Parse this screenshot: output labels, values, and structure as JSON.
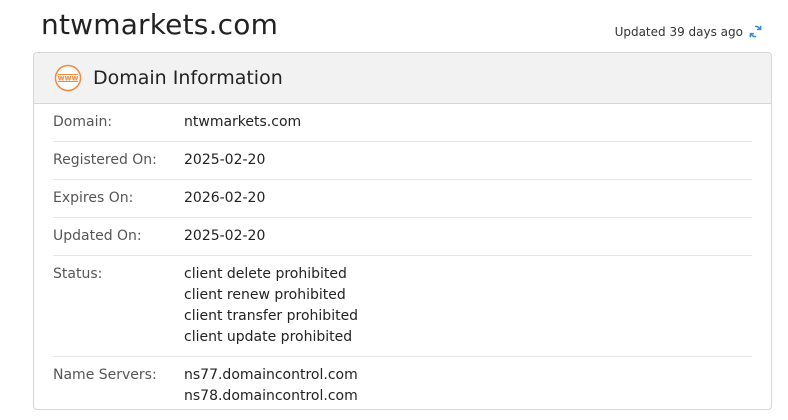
{
  "header": {
    "site_title": "ntwmarkets.com",
    "updated_text": "Updated 39 days ago"
  },
  "card": {
    "title": "Domain Information",
    "icon_text": "www",
    "rows": [
      {
        "label": "Domain:",
        "values": [
          "ntwmarkets.com"
        ]
      },
      {
        "label": "Registered On:",
        "values": [
          "2025-02-20"
        ]
      },
      {
        "label": "Expires On:",
        "values": [
          "2026-02-20"
        ]
      },
      {
        "label": "Updated On:",
        "values": [
          "2025-02-20"
        ]
      },
      {
        "label": "Status:",
        "values": [
          "client delete prohibited",
          "client renew prohibited",
          "client transfer prohibited",
          "client update prohibited"
        ]
      },
      {
        "label": "Name Servers:",
        "values": [
          "ns77.domaincontrol.com",
          "ns78.domaincontrol.com"
        ]
      }
    ]
  },
  "colors": {
    "accent_orange": "#f0883e",
    "refresh_blue": "#2e8bd6"
  }
}
